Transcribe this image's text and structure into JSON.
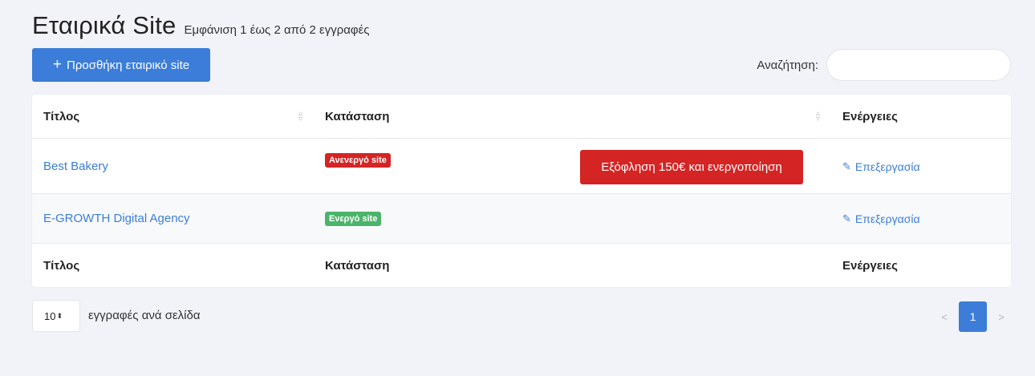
{
  "header": {
    "title": "Εταιρικά Site",
    "subtitle": "Εμφάνιση 1 έως 2 από 2 εγγραφές"
  },
  "toolbar": {
    "add_icon": "plus-icon",
    "add_label": "Προσθήκη εταιρικό site",
    "search_label": "Αναζήτηση:",
    "search_value": ""
  },
  "table": {
    "columns": [
      "Τίτλος",
      "Κατάσταση",
      "Ενέργειες"
    ],
    "rows": [
      {
        "title": "Best Bakery",
        "status": "Ανενεργό site",
        "status_color": "#d42424",
        "action_button": "Εξόφληση 150€ και ενεργοποίηση",
        "edit_label": "Επεξεργασία"
      },
      {
        "title": "E-GROWTH Digital Agency",
        "status": "Ενεργό site",
        "status_color": "#4cb46a",
        "edit_label": "Επεξεργασία"
      }
    ],
    "footer_columns": [
      "Τίτλος",
      "Κατάσταση",
      "Ενέργειες"
    ]
  },
  "footer": {
    "page_length": "10",
    "page_length_label": "εγγραφές ανά σελίδα",
    "pagination": {
      "prev": "<",
      "current": "1",
      "next": ">"
    }
  },
  "colors": {
    "primary": "#3b7dd8",
    "danger": "#d42424",
    "success": "#4cb46a",
    "background": "#f2f3f8"
  }
}
